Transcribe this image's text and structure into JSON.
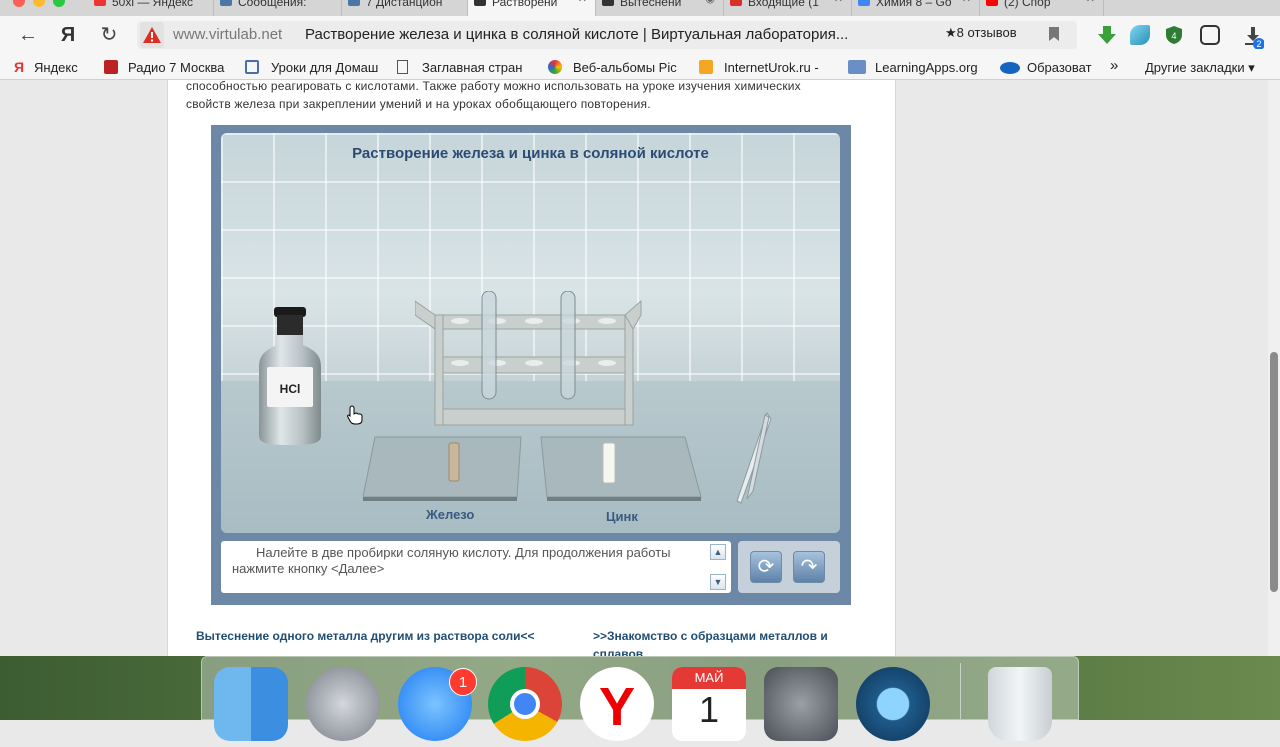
{
  "tabs": [
    {
      "label": "50хі — Яндекс"
    },
    {
      "label": "Сообщения: "
    },
    {
      "label": "7 Дистанцион"
    },
    {
      "label": "Растворени"
    },
    {
      "label": "Вытеснени"
    },
    {
      "label": "Входящие (1"
    },
    {
      "label": "Химия 8 – Go"
    },
    {
      "label": "(2) Спор"
    }
  ],
  "address_bar": {
    "domain": "www.virtulab.net",
    "page_title": "Растворение железа и цинка в соляной кислоте | Виртуальная лаборатория...",
    "reviews": "★8 отзывов"
  },
  "extensions": {
    "badge_count": "4",
    "downloads_count": "2"
  },
  "bookmarks": [
    {
      "label": "Яндекс"
    },
    {
      "label": "Радио 7 Москва"
    },
    {
      "label": "Уроки для Домаш"
    },
    {
      "label": "Заглавная стран"
    },
    {
      "label": "Веб-альбомы Pic"
    },
    {
      "label": "InternetUrok.ru -"
    },
    {
      "label": "LearningApps.org"
    },
    {
      "label": "Образоват"
    }
  ],
  "bookmarks_more": "»",
  "other_bookmarks": "Другие закладки",
  "page": {
    "intro_line1": "способностью реагировать с кислотами. Также работу можно использовать на уроке изучения химических",
    "intro_line2": "свойств железа при закреплении умений и на уроках обобщающего повторения."
  },
  "lab": {
    "title": "Растворение железа и цинка в соляной кислоте",
    "bottle_label": "HCl",
    "plate_left_label": "Железо",
    "plate_right_label": "Цинк",
    "instruction": "Налейте в две пробирки соляную кислоту. Для продолжения работы нажмите кнопку <Далее>",
    "scroll_up": "▲",
    "scroll_down": "▼",
    "restart_icon": "⟳",
    "next_icon": "↷"
  },
  "nav_links": {
    "prev": "Вытеснение одного металла другим из раствора соли<<",
    "next": ">>Знакомство с образцами металлов и сплавов"
  },
  "dock": {
    "appstore_badge": "1",
    "calendar_month": "МАЙ",
    "calendar_day": "1"
  },
  "colors": {
    "lab_frame": "#6c88a6",
    "lab_title": "#2c4b73",
    "link": "#1f4d73"
  }
}
